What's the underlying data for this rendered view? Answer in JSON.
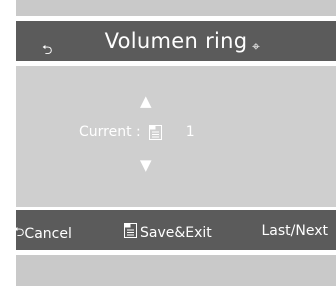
{
  "header": {
    "title": "Volumen ring",
    "back_icon": "return-arrow-icon"
  },
  "main": {
    "current_label": "Current :",
    "current_value": "1",
    "up_icon": "triangle-up-icon",
    "down_icon": "triangle-down-icon"
  },
  "footer_bar": {
    "cancel_label": "Cancel",
    "save_label": "Save&Exit",
    "nav_label": "Last/Next"
  },
  "colors": {
    "bar": "#5b5b5b",
    "panel": "#cfcfcf",
    "strip": "#c9c9c9",
    "text": "#ffffff"
  }
}
